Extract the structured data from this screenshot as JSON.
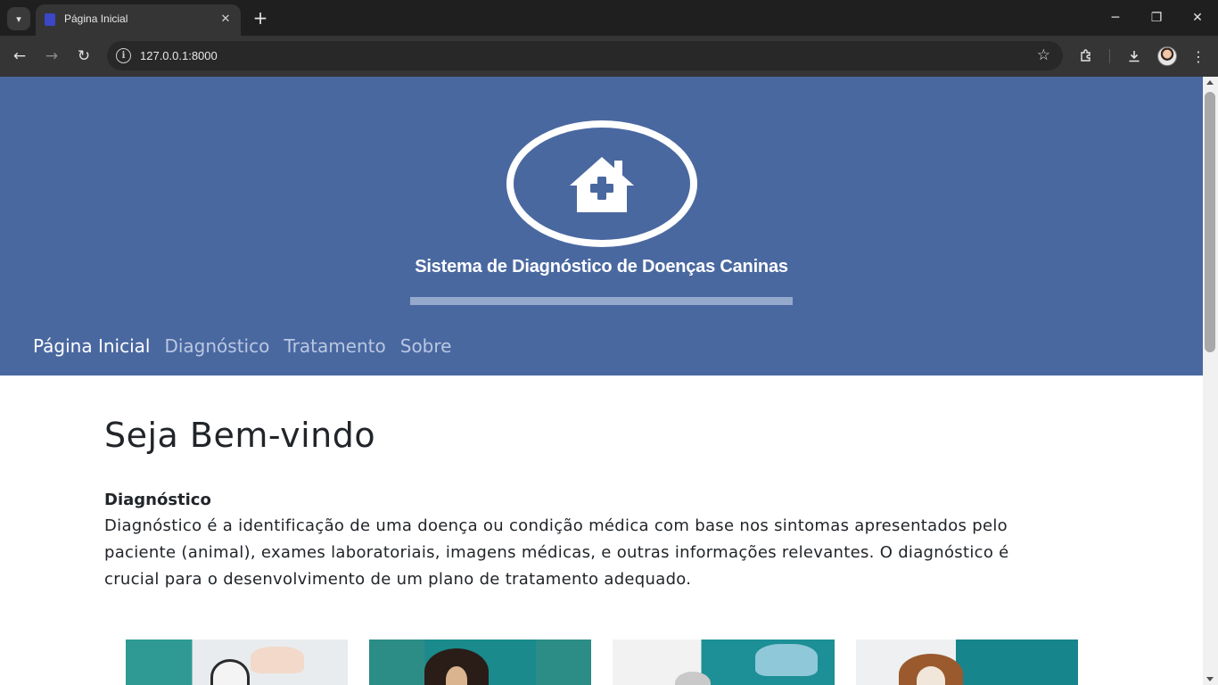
{
  "browser": {
    "tab_title": "Página Inicial",
    "url": "127.0.0.1:8000"
  },
  "header": {
    "logo_icon": "house-medical-icon",
    "site_title": "Sistema de Diagnóstico de Doenças Caninas",
    "nav": [
      {
        "label": "Página Inicial",
        "active": true
      },
      {
        "label": "Diagnóstico",
        "active": false
      },
      {
        "label": "Tratamento",
        "active": false
      },
      {
        "label": "Sobre",
        "active": false
      }
    ]
  },
  "main": {
    "welcome": "Seja Bem-vindo",
    "section_title": "Diagnóstico",
    "section_text": "Diagnóstico é a identificação de uma doença ou condição médica com base nos sintomas apresentados pelo paciente (animal), exames laboratoriais, imagens médicas, e outras informações relevantes. O diagnóstico é crucial para o desenvolvimento de um plano de tratamento adequado."
  },
  "colors": {
    "header_bg": "#4a68a0",
    "nav_active": "#ffffff",
    "nav_inactive": "#b9c7e2",
    "text": "#212529"
  }
}
